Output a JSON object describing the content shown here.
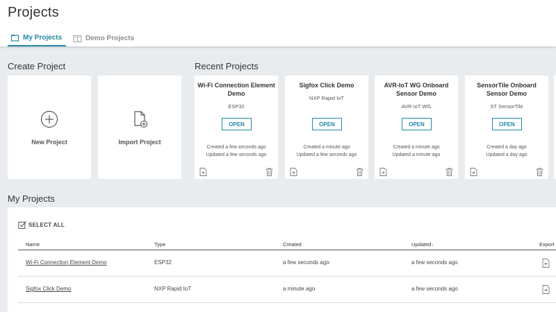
{
  "header": {
    "title": "Projects",
    "tabs": [
      {
        "label": "My Projects",
        "icon": "folder-icon",
        "active": true
      },
      {
        "label": "Demo Projects",
        "icon": "book-icon",
        "active": false
      }
    ]
  },
  "create": {
    "title": "Create Project",
    "cards": [
      {
        "label": "New Project",
        "icon": "plus-circle-icon"
      },
      {
        "label": "Import Project",
        "icon": "import-file-icon"
      }
    ]
  },
  "recent": {
    "title": "Recent Projects",
    "open_label": "OPEN",
    "cards": [
      {
        "title": "Wi-Fi Connection Element Demo",
        "type": "ESP32",
        "created": "Created a few seconds ago",
        "updated": "Updated a few seconds ago"
      },
      {
        "title": "Sigfox Click Demo",
        "type": "NXP Rapid IoT",
        "created": "Created a minute ago",
        "updated": "Updated a few seconds ago"
      },
      {
        "title": "AVR-IoT WG Onboard Sensor Demo",
        "type": "AVR IoT WG",
        "created": "Created a minute ago",
        "updated": "Updated a minute ago"
      },
      {
        "title": "SensorTile Onboard Sensor Demo",
        "type": "ST SensorTile",
        "created": "Created a day ago",
        "updated": "Updated a day ago"
      }
    ]
  },
  "list": {
    "title": "My Projects",
    "select_all": "SELECT ALL",
    "columns": {
      "name": "Name",
      "type": "Type",
      "created": "Created",
      "updated": "Updated",
      "sort_arrow": "↓",
      "export": "Export"
    },
    "rows": [
      {
        "name": "Wi-Fi Connection Element Demo",
        "type": "ESP32",
        "created": "a few seconds ago",
        "updated": "a few seconds ago"
      },
      {
        "name": "Sigfox Click Demo",
        "type": "NXP Rapid IoT",
        "created": "a minute ago",
        "updated": "a few seconds ago"
      }
    ]
  },
  "colors": {
    "accent": "#1f8aa6",
    "background": "#e9ecef",
    "card": "#ffffff"
  }
}
